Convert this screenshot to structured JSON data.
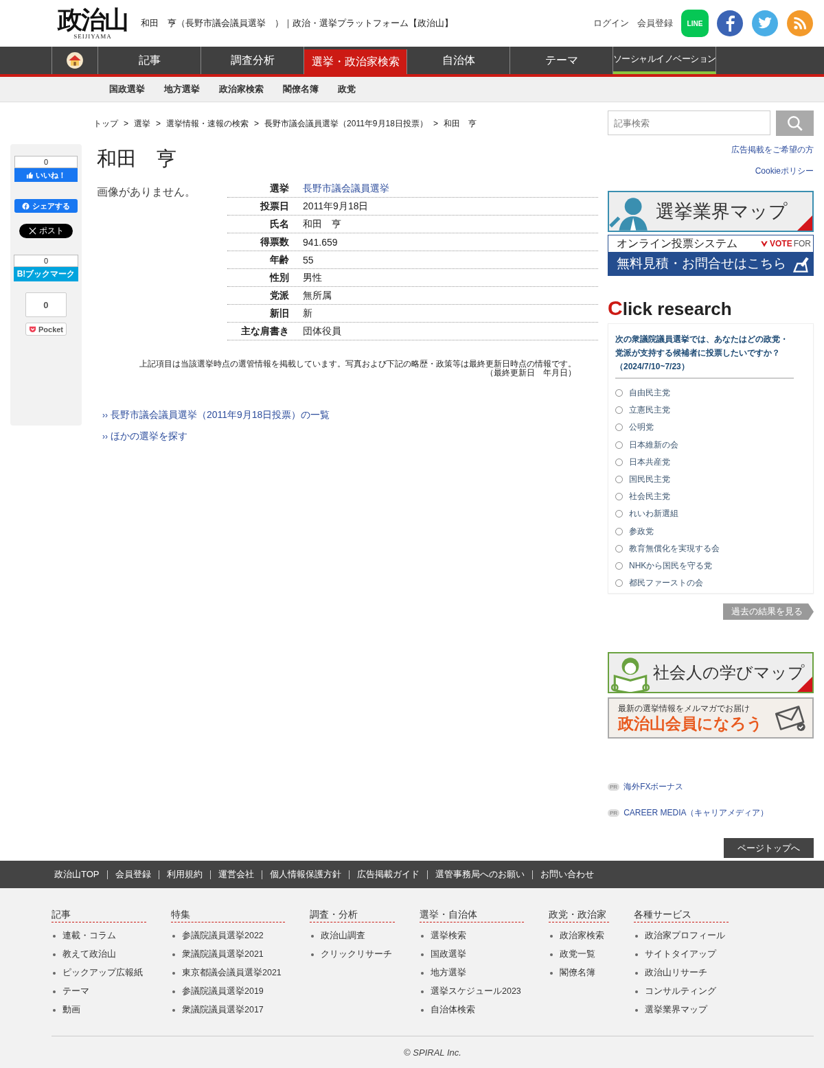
{
  "header": {
    "logo": {
      "text": "政治山",
      "subtext": "SEIJIYAMA"
    },
    "page_title": "和田　亨（長野市議会議員選挙　）｜政治・選挙プラットフォーム【政治山】",
    "links": [
      "ログイン",
      "会員登録"
    ],
    "line_label": "LINE"
  },
  "nav": {
    "items": [
      {
        "kind": "home",
        "selected": false
      },
      {
        "kind": "normal",
        "label": "記事",
        "selected": false
      },
      {
        "kind": "normal",
        "label": "調査分析",
        "selected": false
      },
      {
        "kind": "normal",
        "label": "選挙・政治家検索",
        "selected": true
      },
      {
        "kind": "normal",
        "label": "自治体",
        "selected": false
      },
      {
        "kind": "normal",
        "label": "テーマ",
        "selected": false
      },
      {
        "kind": "accent",
        "label": "ソーシャルイノベーション",
        "selected": false
      }
    ],
    "subnav": [
      "国政選挙",
      "地方選挙",
      "政治家検索",
      "閣僚名簿",
      "政党"
    ]
  },
  "breadcrumb": {
    "separator": ">",
    "items": [
      "トップ",
      "選挙",
      "選挙情報・速報の検索",
      "長野市議会議員選挙（2011年9月18日投票）",
      "和田　亨"
    ]
  },
  "share": {
    "like": {
      "count": "0",
      "label": "いいね！"
    },
    "share_label": "シェアする",
    "post_label": "ポスト",
    "hatena": {
      "count": "0",
      "label": "B!ブックマーク"
    },
    "pocket": {
      "count": "0",
      "label": "Pocket"
    }
  },
  "profile": {
    "name": "和田　亨",
    "no_image": "画像がありません。",
    "fields": [
      {
        "label": "選挙",
        "value": "長野市議会議員選挙",
        "link": true
      },
      {
        "label": "投票日",
        "value": "2011年9月18日",
        "link": false
      },
      {
        "label": "氏名",
        "value": "和田　亨",
        "link": false
      },
      {
        "label": "得票数",
        "value": "941.659",
        "link": false
      },
      {
        "label": "年齢",
        "value": "55",
        "link": false
      },
      {
        "label": "性別",
        "value": "男性",
        "link": false
      },
      {
        "label": "党派",
        "value": "無所属",
        "link": false
      },
      {
        "label": "新旧",
        "value": "新",
        "link": false
      },
      {
        "label": "主な肩書き",
        "value": "団体役員",
        "link": false
      }
    ],
    "note": "上記項目は当該選挙時点の選管情報を掲載しています。写真および下記の略歴・政策等は最終更新日時点の情報です。",
    "updated": "（最終更新日　年月日）",
    "links": [
      {
        "marker": "››",
        "text": "長野市議会議員選挙（2011年9月18日投票）の一覧"
      },
      {
        "marker": "››",
        "text": "ほかの選挙を探す"
      }
    ]
  },
  "sidebar": {
    "search": {
      "placeholder": "記事検索"
    },
    "links": [
      "広告掲載をご希望の方",
      "Cookieポリシー"
    ],
    "banner_map": "選挙業界マップ",
    "banner_vote": {
      "top": "オンライン投票システム",
      "brand_bold": "VOTE",
      "brand_light": "FOR",
      "bottom": "無料見積・お問合せはこちら"
    },
    "poll": {
      "title_initial": "C",
      "title_rest": "lick research",
      "question": "次の衆議院議員選挙では、あなたはどの政党・党派が支持する候補者に投票したいですか？",
      "period": "（2024/7/10~7/23）",
      "options": [
        {
          "label": "自由民主党",
          "selected": false
        },
        {
          "label": "立憲民主党",
          "selected": false
        },
        {
          "label": "公明党",
          "selected": false
        },
        {
          "label": "日本維新の会",
          "selected": false
        },
        {
          "label": "日本共産党",
          "selected": false
        },
        {
          "label": "国民民主党",
          "selected": false
        },
        {
          "label": "社会民主党",
          "selected": false
        },
        {
          "label": "れいわ新選組",
          "selected": false
        },
        {
          "label": "参政党",
          "selected": false
        },
        {
          "label": "教育無償化を実現する会",
          "selected": false
        },
        {
          "label": "NHKから国民を守る党",
          "selected": false
        },
        {
          "label": "都民ファーストの会",
          "selected": false
        }
      ],
      "past_results": "過去の結果を見る"
    },
    "banner_learn": "社会人の学びマップ",
    "banner_member": {
      "top": "最新の選挙情報をメルマガでお届け",
      "main": "政治山会員になろう"
    },
    "pr_links": [
      {
        "badge": "PR",
        "text": "海外FXボーナス"
      },
      {
        "badge": "PR",
        "text": "CAREER MEDIA（キャリアメディア）"
      }
    ],
    "page_top": "ページトップへ"
  },
  "footer": {
    "links": [
      "政治山TOP",
      "会員登録",
      "利用規約",
      "運営会社",
      "個人情報保護方針",
      "広告掲載ガイド",
      "選管事務局へのお願い",
      "お問い合わせ"
    ],
    "columns": [
      {
        "heading": "記事",
        "items": [
          "連載・コラム",
          "教えて政治山",
          "ピックアップ広報紙",
          "テーマ",
          "動画"
        ]
      },
      {
        "heading": "特集",
        "items": [
          "参議院議員選挙2022",
          "衆議院議員選挙2021",
          "東京都議会議員選挙2021",
          "参議院議員選挙2019",
          "衆議院議員選挙2017"
        ]
      },
      {
        "heading": "調査・分析",
        "items": [
          "政治山調査",
          "クリックリサーチ"
        ]
      },
      {
        "heading": "選挙・自治体",
        "items": [
          "選挙検索",
          "国政選挙",
          "地方選挙",
          "選挙スケジュール2023",
          "自治体検索"
        ]
      },
      {
        "heading": "政党・政治家",
        "items": [
          "政治家検索",
          "政党一覧",
          "閣僚名簿"
        ]
      },
      {
        "heading": "各種サービス",
        "items": [
          "政治家プロフィール",
          "サイトタイアップ",
          "政治山リサーチ",
          "コンサルティング",
          "選挙業界マップ"
        ]
      }
    ],
    "copyright": "© SPIRAL Inc."
  }
}
